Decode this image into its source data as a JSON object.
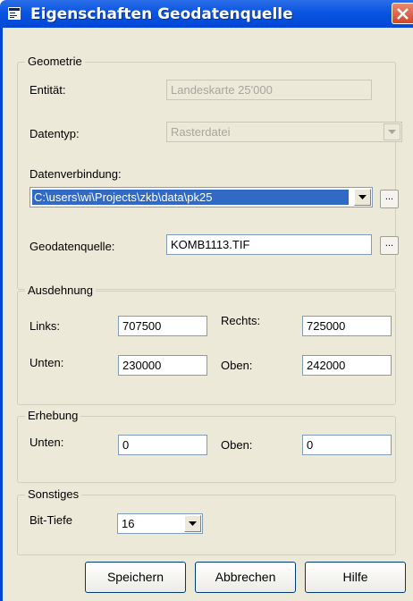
{
  "window": {
    "title": "Eigenschaften Geodatenquelle"
  },
  "geometrie": {
    "legend": "Geometrie",
    "entitaet_label": "Entität:",
    "entitaet_value": "Landeskarte 25'000",
    "datentyp_label": "Datentyp:",
    "datentyp_value": "Rasterdatei",
    "datenverbindung_label": "Datenverbindung:",
    "datenverbindung_value": "C:\\users\\wi\\Projects\\zkb\\data\\pk25",
    "geodatenquelle_label": "Geodatenquelle:",
    "geodatenquelle_value": "KOMB1113.TIF",
    "browse_label": "..."
  },
  "ausdehnung": {
    "legend": "Ausdehnung",
    "links_label": "Links:",
    "links_value": "707500",
    "rechts_label": "Rechts:",
    "rechts_value": "725000",
    "unten_label": "Unten:",
    "unten_value": "230000",
    "oben_label": "Oben:",
    "oben_value": "242000"
  },
  "erhebung": {
    "legend": "Erhebung",
    "unten_label": "Unten:",
    "unten_value": "0",
    "oben_label": "Oben:",
    "oben_value": "0"
  },
  "sonstiges": {
    "legend": "Sonstiges",
    "bittiefe_label": "Bit-Tiefe",
    "bittiefe_value": "16"
  },
  "buttons": {
    "save": "Speichern",
    "cancel": "Abbrechen",
    "help": "Hilfe"
  },
  "icons": {
    "title": "window-icon",
    "close": "close-icon",
    "dropdown": "chevron-down-icon"
  },
  "colors": {
    "titlebar": "#0a55e0",
    "client": "#ece9d8",
    "selection": "#316ac5",
    "close": "#d2452a"
  }
}
